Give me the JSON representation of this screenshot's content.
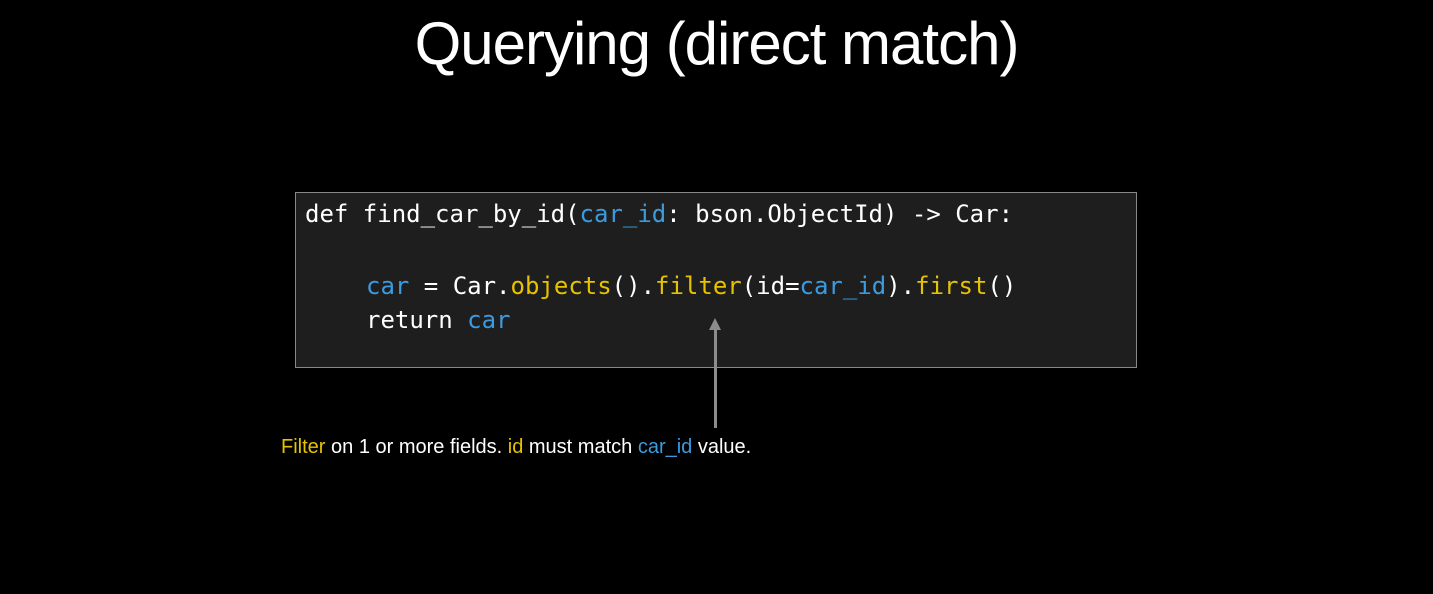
{
  "slide": {
    "title": "Querying (direct match)"
  },
  "code": {
    "line1": {
      "kw_def": "def ",
      "func_name": "find_car_by_id(",
      "param": "car_id",
      "rest": ": bson.ObjectId) -> Car:"
    },
    "line2": {
      "var": "car",
      "assign": " = Car.",
      "m_objects": "objects",
      "p1": "().",
      "m_filter": "filter",
      "p2": "(id=",
      "arg": "car_id",
      "p3": ").",
      "m_first": "first",
      "p4": "()"
    },
    "line3": {
      "kw_return": "return ",
      "var": "car"
    }
  },
  "caption": {
    "filter_word": "Filter",
    "text1": " on 1 or more fields. ",
    "id_word": "id",
    "text2": " must match ",
    "car_id_word": "car_id",
    "text3": " value."
  },
  "colors": {
    "background": "#000000",
    "code_background": "#1e1e1e",
    "keyword_blue": "#3b9bdf",
    "method_yellow": "#e6c200",
    "arrow_gray": "#8c8c8c"
  }
}
